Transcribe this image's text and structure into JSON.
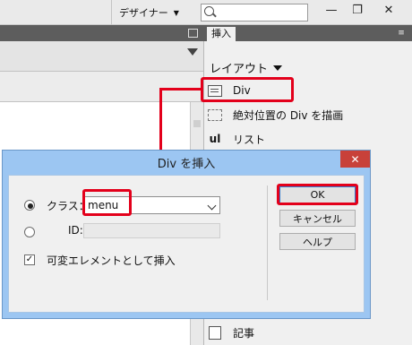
{
  "toolbar": {
    "designer_label": "デザイナー",
    "search_placeholder": ""
  },
  "panel": {
    "tab_label": "挿入",
    "category_label": "レイアウト",
    "items": [
      {
        "label": "Div",
        "icon": "div-icon"
      },
      {
        "label": "絶対位置の Div を描画",
        "icon": "ap-div-icon"
      },
      {
        "label": "リスト",
        "icon": "ul-icon",
        "icon_text": "ul"
      },
      {
        "label": "記事",
        "icon": "article-icon"
      }
    ]
  },
  "dialog": {
    "title": "Div を挿入",
    "close_glyph": "✕",
    "class_label": "クラス：",
    "class_value": "menu",
    "id_label": "ID:",
    "id_value": "",
    "flex_label": "可変エレメントとして挿入",
    "flex_checked": true,
    "ok_label": "OK",
    "cancel_label": "キャンセル",
    "help_label": "ヘルプ"
  },
  "colors": {
    "highlight": "#e3001b",
    "dialog_frame": "#9cc6f2",
    "close_button": "#c8413a"
  }
}
